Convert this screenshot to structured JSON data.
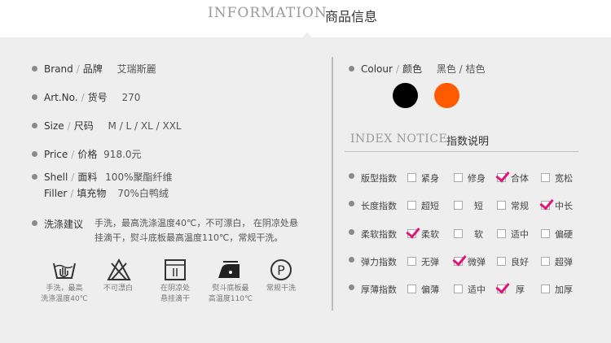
{
  "header": {
    "title_en": "INFORMATION",
    "title_cn": "商品信息"
  },
  "specs": [
    {
      "label_en": "Brand",
      "label_cn": "品牌",
      "value": "艾瑞斯麗"
    },
    {
      "label_en": "Art.No.",
      "label_cn": "货号",
      "value": "270"
    },
    {
      "label_en": "Size",
      "label_cn": "尺码",
      "value": "M / L / XL / XXL"
    },
    {
      "label_en": "Price",
      "label_cn": "价格",
      "value": "918.0元"
    }
  ],
  "material": {
    "shell": {
      "label_en": "Shell",
      "label_cn": "面料",
      "value": "100%聚酯纤维"
    },
    "filler": {
      "label_en": "Filler",
      "label_cn": "填充物",
      "value": "70%白鸭绒"
    }
  },
  "wash": {
    "label": "洗涤建议",
    "note_line1": "手洗，最高洗涤温度40℃，不可漂白， 在阴凉处悬",
    "note_line2": "挂滴干，熨斗底板最高温度110℃，常规干洗。",
    "care": [
      {
        "icon": "hand-wash-icon",
        "line1": "手洗，最高",
        "line2": "洗涤温度40℃"
      },
      {
        "icon": "no-bleach-icon",
        "line1": "不可漂白",
        "line2": ""
      },
      {
        "icon": "drip-dry-icon",
        "line1": "在阴凉处",
        "line2": "悬挂滴干"
      },
      {
        "icon": "iron-icon",
        "line1": "熨斗底板最",
        "line2": "高温度110℃"
      },
      {
        "icon": "dry-clean-icon",
        "line1": "常规干洗",
        "line2": "",
        "symbol": "P"
      }
    ]
  },
  "colour": {
    "label_en": "Colour",
    "label_cn": "颜色",
    "value": "黑色 / 桔色",
    "swatches": [
      "#000000",
      "#ff5a00"
    ]
  },
  "index": {
    "title_en": "INDEX NOTICE",
    "title_cn": "指数说明",
    "check_color": "#e0157a",
    "rows": [
      {
        "label": "版型指数",
        "options": [
          "紧身",
          "修身",
          "合体",
          "宽松"
        ],
        "checked": 2
      },
      {
        "label": "长度指数",
        "options": [
          "超短",
          "短",
          "常规",
          "中长"
        ],
        "checked": 3
      },
      {
        "label": "柔软指数",
        "options": [
          "柔软",
          "软",
          "适中",
          "偏硬"
        ],
        "checked": 0
      },
      {
        "label": "弹力指数",
        "options": [
          "无弹",
          "微弹",
          "良好",
          "超弹"
        ],
        "checked": 1
      },
      {
        "label": "厚薄指数",
        "options": [
          "偏薄",
          "适中",
          "厚",
          "加厚"
        ],
        "checked": 2
      }
    ]
  }
}
